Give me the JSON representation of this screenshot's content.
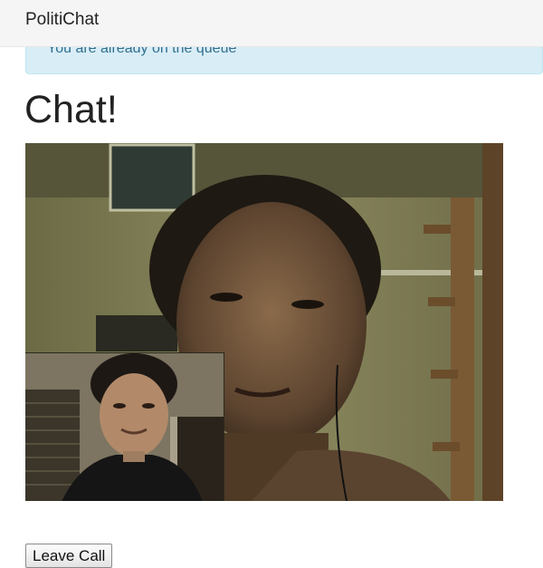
{
  "navbar": {
    "brand": "PolitiChat"
  },
  "alert": {
    "message": "You are already on the queue",
    "color": "#d9edf7"
  },
  "main": {
    "title": "Chat!",
    "remote_video": {
      "description": "Remote participant video feed"
    },
    "local_video": {
      "description": "Local self-view video feed"
    },
    "leave_button_label": "Leave Call"
  }
}
